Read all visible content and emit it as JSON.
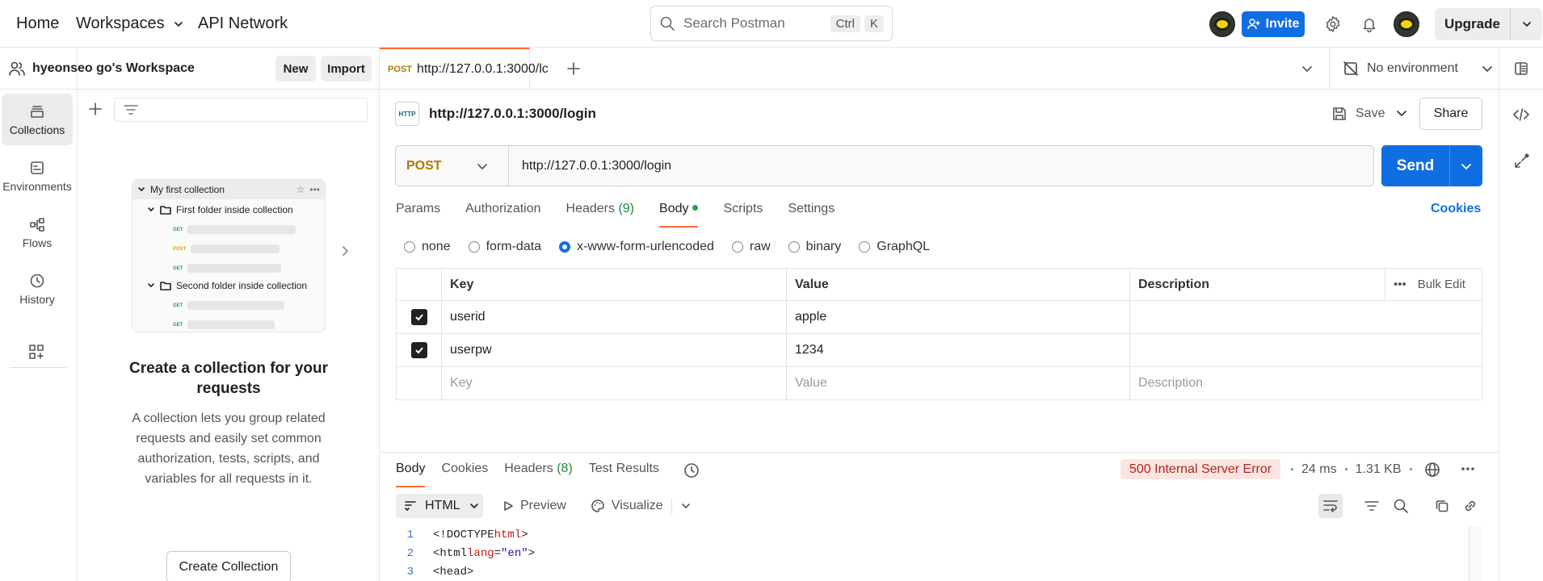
{
  "topbar": {
    "home": "Home",
    "workspaces": "Workspaces",
    "api_network": "API Network",
    "search_placeholder": "Search Postman",
    "shortcut_ctrl": "Ctrl",
    "shortcut_key": "K",
    "invite": "Invite",
    "upgrade": "Upgrade"
  },
  "rail": {
    "items": [
      {
        "label": "Collections",
        "icon": "collections-icon"
      },
      {
        "label": "Environments",
        "icon": "environments-icon"
      },
      {
        "label": "Flows",
        "icon": "flows-icon"
      },
      {
        "label": "History",
        "icon": "history-icon"
      }
    ]
  },
  "sidebar": {
    "workspace_title": "hyeonseo go's Workspace",
    "new": "New",
    "import": "Import",
    "illustration": {
      "collection": "My first collection",
      "folder1": "First folder inside collection",
      "folder2": "Second folder inside collection",
      "methods": [
        "GET",
        "POST",
        "GET",
        "GET",
        "GET"
      ]
    },
    "empty_title": "Create a collection for your requests",
    "empty_desc": "A collection lets you group related requests and easily set common authorization, tests, scripts, and variables for all requests in it.",
    "create_button": "Create Collection"
  },
  "tabs": {
    "active_method": "POST",
    "active_url": "http://127.0.0.1:3000/lc",
    "environment": "No environment"
  },
  "request": {
    "title": "http://127.0.0.1:3000/login",
    "save": "Save",
    "share": "Share",
    "method": "POST",
    "url": "http://127.0.0.1:3000/login",
    "send": "Send",
    "tabs": {
      "params": "Params",
      "authorization": "Authorization",
      "headers": "Headers",
      "headers_count": "(9)",
      "body": "Body",
      "scripts": "Scripts",
      "settings": "Settings"
    },
    "cookies": "Cookies",
    "body_types": [
      "none",
      "form-data",
      "x-www-form-urlencoded",
      "raw",
      "binary",
      "GraphQL"
    ],
    "selected_body_type": "x-www-form-urlencoded",
    "table": {
      "headers": {
        "key": "Key",
        "value": "Value",
        "description": "Description",
        "bulk_edit": "Bulk Edit"
      },
      "rows": [
        {
          "key": "userid",
          "value": "apple",
          "description": ""
        },
        {
          "key": "userpw",
          "value": "1234",
          "description": ""
        }
      ],
      "placeholders": {
        "key": "Key",
        "value": "Value",
        "description": "Description"
      }
    }
  },
  "response": {
    "tabs": {
      "body": "Body",
      "cookies": "Cookies",
      "headers": "Headers",
      "headers_count": "(8)",
      "test_results": "Test Results"
    },
    "status": "500 Internal Server Error",
    "time": "24 ms",
    "size": "1.31 KB",
    "format": "HTML",
    "preview": "Preview",
    "visualize": "Visualize",
    "code": {
      "line1": {
        "num": "1",
        "open": "<!DOCTYPE ",
        "kw": "html",
        "close": ">"
      },
      "line2": {
        "num": "2",
        "open": "<",
        "tag": "html",
        "attr": " lang",
        "eq": "=",
        "val": "\"en\"",
        "close": ">"
      },
      "line3": {
        "num": "3",
        "text": "<head>"
      }
    }
  },
  "colors": {
    "accent": "#ff6c37",
    "primary": "#0f6fe2",
    "post_method": "#ad7a03",
    "error_bg": "#fbe5e2",
    "error_text": "#b3261e"
  }
}
